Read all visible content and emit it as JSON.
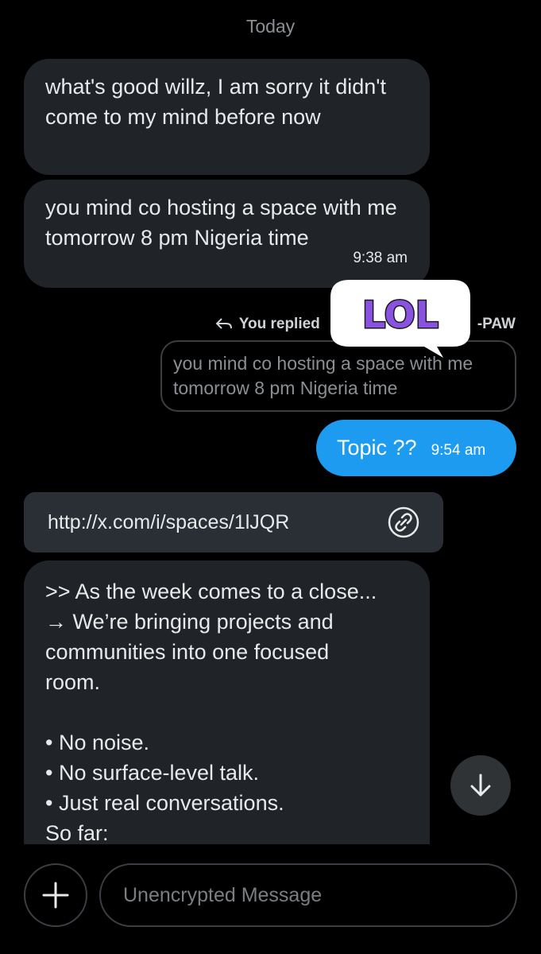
{
  "date_separator": "Today",
  "messages": {
    "m1": "what's good willz, I am sorry it didn't come to my mind before now",
    "m2": "you mind co hosting a space with me tomorrow 8 pm Nigeria time",
    "m2_time": "9:38 am",
    "reply_header": "You replied",
    "reply_to_name": "-PAW",
    "quote": "you mind co hosting a space with me tomorrow 8 pm Nigeria time",
    "m3": "Topic ??",
    "m3_time": "9:54 am",
    "link": "http://x.com/i/spaces/1lJQR",
    "m4_lines": [
      ">> As the week comes to a close...",
      "→ We’re bringing projects and",
      "communities into one focused",
      "room.",
      "",
      "• No noise.",
      "• No surface-level talk.",
      "• Just real conversations.",
      "So far:"
    ]
  },
  "sticker_text": "LOL",
  "composer": {
    "placeholder": "Unencrypted Message"
  },
  "colors": {
    "accent": "#1d9bf0",
    "bubble_in": "#202327",
    "background": "#000000"
  },
  "icons": {
    "reply": "reply-arrow-icon",
    "link": "link-icon",
    "scroll": "arrow-down-icon",
    "add": "plus-icon"
  }
}
